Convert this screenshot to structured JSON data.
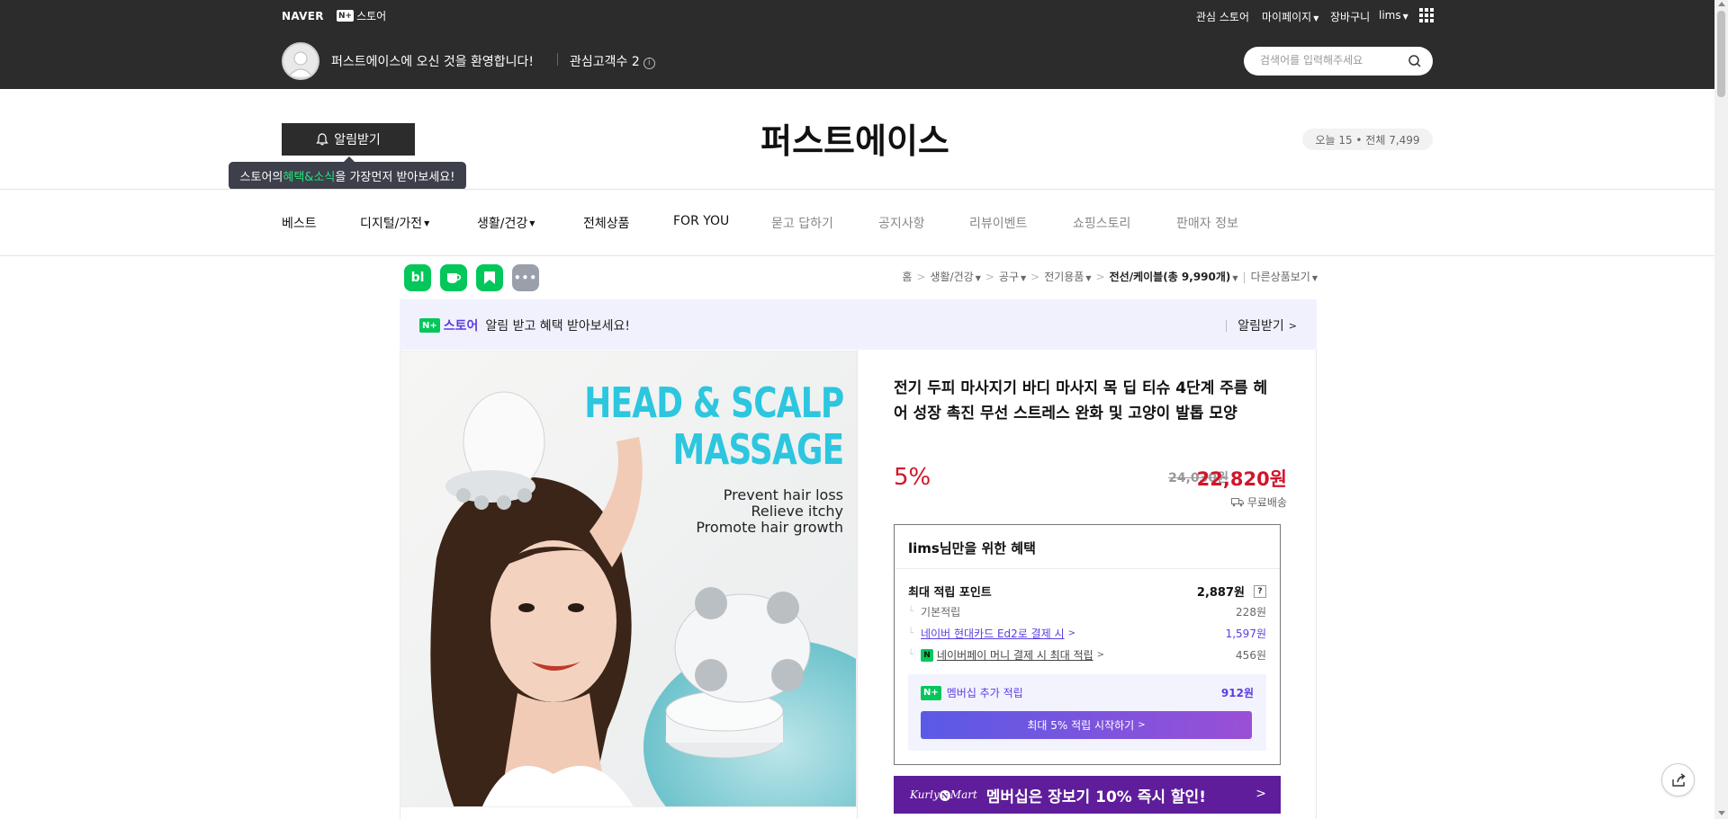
{
  "topbar": {
    "naver_logo": "NAVER",
    "npay_logo": "N+",
    "store_label": "스토어",
    "links": [
      "관심 스토어",
      "마이페이지",
      "장바구니",
      "lims"
    ],
    "welcome": "퍼스트에이스에 오신 것을 환영합니다!",
    "interest_customers": "관심고객수 2",
    "search_placeholder": "검색어를 입력해주세요"
  },
  "store": {
    "alarm_button": "알림받기",
    "tooltip_pre": "스토어의 ",
    "tooltip_hl": "혜택&소식",
    "tooltip_post": "을 가장먼저 받아보세요!",
    "name": "퍼스트에이스",
    "visits": "오늘 15 • 전체 7,499"
  },
  "nav": {
    "items": [
      {
        "label": "베스트",
        "caret": false
      },
      {
        "label": "디지털/가전",
        "caret": true
      },
      {
        "label": "생활/건강",
        "caret": true
      },
      {
        "label": "전체상품",
        "caret": false
      },
      {
        "label": "FOR YOU",
        "caret": false
      },
      {
        "label": "묻고 답하기",
        "caret": false
      },
      {
        "label": "공지사항",
        "caret": false
      },
      {
        "label": "리뷰이벤트",
        "caret": false
      },
      {
        "label": "쇼핑스토리",
        "caret": false
      },
      {
        "label": "판매자 정보",
        "caret": false
      }
    ]
  },
  "app_icons": [
    "bl",
    "cafe",
    "bookmark",
    "more"
  ],
  "breadcrumb": {
    "home": "홈",
    "c1": "생활/건강",
    "c2": "공구",
    "c3": "전기용품",
    "c4": "전선/케이블",
    "c4_count": "(총 9,990개)",
    "other": "다른상품보기"
  },
  "notify_banner": {
    "logo": "N+",
    "store": "스토어",
    "text": "알림 받고 혜택 받아보세요!",
    "action": "알림받기"
  },
  "product_image": {
    "line1": "HEAD & SCALP",
    "line2": "MASSAGE",
    "sub1": "Prevent hair loss",
    "sub2": "Relieve itchy",
    "sub3": "Promote hair growth"
  },
  "product": {
    "name": "전기 두피 마사지기 바디 마사지 목 딥 티슈 4단계 주름 헤어 성장 촉진 무선 스트레스 완화 및 고양이 발톱 모양",
    "discount": "5%",
    "original_price": "24,030원",
    "price": "22,820원",
    "shipping": "무료배송"
  },
  "benefit": {
    "title": "lims님만을 위한 혜택",
    "max_points_label": "최대 적립 포인트",
    "max_points_value": "2,887원",
    "help": "?",
    "basic_label": "기본적립",
    "basic_value": "228원",
    "card_label": "네이버 현대카드 Ed2로 결제 시",
    "card_value": "1,597원",
    "npay_label": "네이버페이 머니 결제 시 최대 적립",
    "npay_value": "456원",
    "npay_icon": "N",
    "member_logo": "N+",
    "member_label": "멤버십 추가 적립",
    "member_value": "912원",
    "member_button": "최대 5% 적립 시작하기"
  },
  "kurly_banner": {
    "logo": "Kurly",
    "logo_n": "N",
    "logo_mart": "Mart",
    "text": "멤버십은 장보기 10% 즉시 할인!"
  },
  "colors": {
    "topbar": "#2c2c2c",
    "naver_green": "#03c75a",
    "price_red": "#d3142a",
    "purple": "#5a3de0",
    "kurly_purple": "#5f1d9b"
  }
}
